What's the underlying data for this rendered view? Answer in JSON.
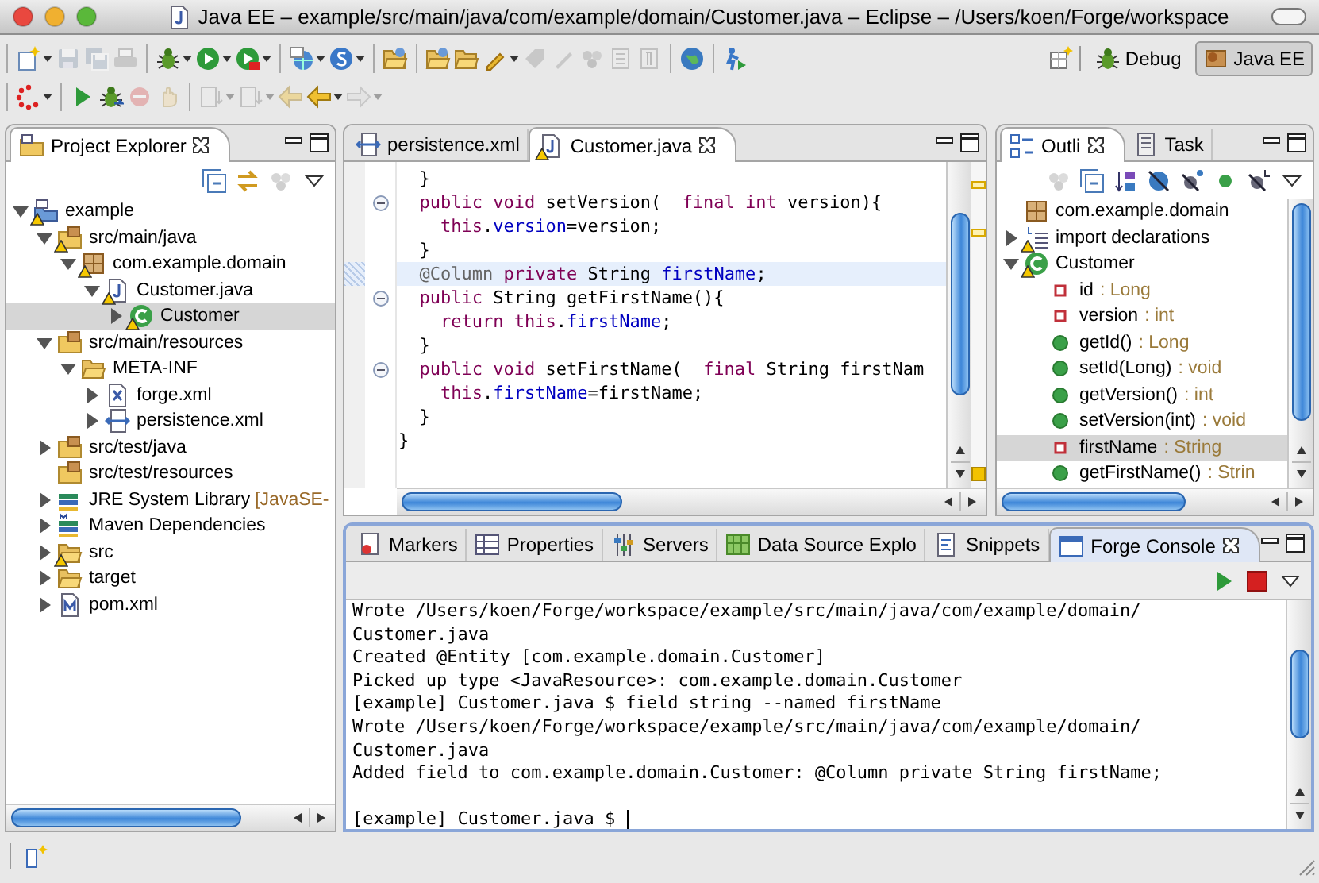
{
  "window": {
    "title": "Java EE – example/src/main/java/com/example/domain/Customer.java – Eclipse – /Users/koen/Forge/workspace"
  },
  "toolbar": {
    "rows": [
      [
        [
          {
            "kind": "new",
            "disabled": false,
            "dropdown": true
          },
          {
            "kind": "save",
            "disabled": true,
            "dropdown": false
          },
          {
            "kind": "save-all",
            "disabled": true,
            "dropdown": false
          },
          {
            "kind": "print",
            "disabled": true,
            "dropdown": false
          }
        ],
        [
          {
            "kind": "bug",
            "disabled": false,
            "dropdown": true
          },
          {
            "kind": "run",
            "disabled": false,
            "dropdown": true
          },
          {
            "kind": "external",
            "disabled": false,
            "dropdown": true
          }
        ],
        [
          {
            "kind": "server",
            "disabled": false,
            "dropdown": true
          },
          {
            "kind": "service",
            "disabled": false,
            "dropdown": true
          }
        ],
        [
          {
            "kind": "open",
            "disabled": false,
            "dropdown": false
          }
        ],
        [
          {
            "kind": "open",
            "disabled": false,
            "dropdown": false
          },
          {
            "kind": "folder",
            "disabled": false,
            "dropdown": false
          },
          {
            "kind": "pen",
            "disabled": false,
            "dropdown": true
          },
          {
            "kind": "tag",
            "disabled": true,
            "dropdown": false
          },
          {
            "kind": "pencil",
            "disabled": true,
            "dropdown": false
          },
          {
            "kind": "dots",
            "disabled": true,
            "dropdown": false
          },
          {
            "kind": "page",
            "disabled": true,
            "dropdown": false
          },
          {
            "kind": "paragraph",
            "disabled": true,
            "dropdown": false
          }
        ],
        [
          {
            "kind": "globe",
            "disabled": false,
            "dropdown": false
          }
        ],
        [
          {
            "kind": "runner",
            "disabled": false,
            "dropdown": false
          }
        ]
      ],
      [
        [
          {
            "kind": "spinner",
            "disabled": false,
            "dropdown": true
          }
        ],
        [
          {
            "kind": "play",
            "disabled": false,
            "dropdown": false
          },
          {
            "kind": "step",
            "disabled": false,
            "dropdown": false
          },
          {
            "kind": "stop",
            "disabled": true,
            "dropdown": false
          },
          {
            "kind": "hand",
            "disabled": true,
            "dropdown": false
          }
        ],
        [
          {
            "kind": "page-arrow",
            "disabled": true,
            "dropdown": true
          },
          {
            "kind": "page-arrow",
            "disabled": true,
            "dropdown": true
          },
          {
            "kind": "back",
            "disabled": true,
            "dropdown": false
          },
          {
            "kind": "back",
            "disabled": false,
            "dropdown": true
          },
          {
            "kind": "forward",
            "disabled": true,
            "dropdown": true
          }
        ]
      ]
    ]
  },
  "perspectives": [
    {
      "label": "Debug",
      "kind": "bug",
      "selected": false
    },
    {
      "label": "Java EE",
      "kind": "javaee",
      "selected": true
    }
  ],
  "project_explorer": {
    "tabs": [
      {
        "label": "Project Explorer",
        "kind": "explorer",
        "selected": true
      }
    ],
    "toolbar": [
      {
        "kind": "collapse",
        "disabled": false
      },
      {
        "kind": "link",
        "disabled": false
      },
      {
        "kind": "dots",
        "disabled": true
      },
      {
        "kind": "menu",
        "disabled": false
      }
    ],
    "tree": [
      {
        "label": "example",
        "kind": "project",
        "warning": true,
        "expanded": true,
        "selected": false,
        "children": [
          {
            "label": "src/main/java",
            "kind": "src",
            "warning": true,
            "expanded": true,
            "selected": false,
            "children": [
              {
                "label": "com.example.domain",
                "kind": "package",
                "warning": true,
                "expanded": true,
                "selected": false,
                "children": [
                  {
                    "label": "Customer.java",
                    "kind": "java",
                    "warning": true,
                    "expanded": true,
                    "selected": false,
                    "children": [
                      {
                        "label": "Customer",
                        "kind": "class",
                        "warning": true,
                        "expanded": false,
                        "selected": true
                      }
                    ]
                  }
                ]
              }
            ]
          },
          {
            "label": "src/main/resources",
            "kind": "src",
            "warning": false,
            "expanded": true,
            "selected": false,
            "children": [
              {
                "label": "META-INF",
                "kind": "folder-open",
                "warning": false,
                "expanded": true,
                "selected": false,
                "children": [
                  {
                    "label": "forge.xml",
                    "kind": "xml",
                    "warning": false,
                    "expanded": false,
                    "selected": false
                  },
                  {
                    "label": "persistence.xml",
                    "kind": "persistence",
                    "warning": false,
                    "expanded": false,
                    "selected": false
                  }
                ]
              }
            ]
          },
          {
            "label": "src/test/java",
            "kind": "src",
            "warning": false,
            "expanded": false,
            "selected": false
          },
          {
            "label": "src/test/resources",
            "kind": "src",
            "warning": false,
            "selected": false
          },
          {
            "label": "JRE System Library",
            "decoration": "[JavaSE-",
            "kind": "library",
            "warning": false,
            "expanded": false,
            "selected": false
          },
          {
            "label": "Maven Dependencies",
            "kind": "maven",
            "warning": false,
            "expanded": false,
            "selected": false
          },
          {
            "label": "src",
            "kind": "folder-open",
            "warning": true,
            "expanded": false,
            "selected": false
          },
          {
            "label": "target",
            "kind": "folder-open",
            "warning": false,
            "expanded": false,
            "selected": false
          },
          {
            "label": "pom.xml",
            "kind": "pom",
            "warning": false,
            "expanded": false,
            "selected": false
          }
        ]
      }
    ]
  },
  "editor": {
    "tabs": [
      {
        "label": "persistence.xml",
        "kind": "persistence",
        "warning": false,
        "selected": false
      },
      {
        "label": "Customer.java",
        "kind": "java",
        "warning": true,
        "selected": true
      }
    ],
    "lines": [
      {
        "fold": false,
        "highlighted": false,
        "tokens": [
          {
            "kind": "plain",
            "text": "  }"
          }
        ]
      },
      {
        "fold": true,
        "highlighted": false,
        "tokens": [
          {
            "kind": "keyword",
            "text": "  public void"
          },
          {
            "kind": "plain",
            "text": " setVersion(  "
          },
          {
            "kind": "keyword",
            "text": "final int"
          },
          {
            "kind": "plain",
            "text": " version){"
          }
        ]
      },
      {
        "fold": false,
        "highlighted": false,
        "tokens": [
          {
            "kind": "keyword",
            "text": "    this"
          },
          {
            "kind": "plain",
            "text": "."
          },
          {
            "kind": "field",
            "text": "version"
          },
          {
            "kind": "plain",
            "text": "=version;"
          }
        ]
      },
      {
        "fold": false,
        "highlighted": false,
        "tokens": [
          {
            "kind": "plain",
            "text": "  }"
          }
        ]
      },
      {
        "fold": false,
        "highlighted": true,
        "tokens": [
          {
            "kind": "annotation",
            "text": "  @Column"
          },
          {
            "kind": "keyword",
            "text": " private"
          },
          {
            "kind": "plain",
            "text": " String "
          },
          {
            "kind": "field",
            "text": "firstName"
          },
          {
            "kind": "plain",
            "text": ";"
          }
        ]
      },
      {
        "fold": true,
        "highlighted": false,
        "tokens": [
          {
            "kind": "keyword",
            "text": "  public"
          },
          {
            "kind": "plain",
            "text": " String getFirstName(){"
          }
        ]
      },
      {
        "fold": false,
        "highlighted": false,
        "tokens": [
          {
            "kind": "keyword",
            "text": "    return this"
          },
          {
            "kind": "plain",
            "text": "."
          },
          {
            "kind": "field",
            "text": "firstName"
          },
          {
            "kind": "plain",
            "text": ";"
          }
        ]
      },
      {
        "fold": false,
        "highlighted": false,
        "tokens": [
          {
            "kind": "plain",
            "text": "  }"
          }
        ]
      },
      {
        "fold": true,
        "highlighted": false,
        "tokens": [
          {
            "kind": "keyword",
            "text": "  public void"
          },
          {
            "kind": "plain",
            "text": " setFirstName(  "
          },
          {
            "kind": "keyword",
            "text": "final"
          },
          {
            "kind": "plain",
            "text": " String firstNam"
          }
        ]
      },
      {
        "fold": false,
        "highlighted": false,
        "tokens": [
          {
            "kind": "keyword",
            "text": "    this"
          },
          {
            "kind": "plain",
            "text": "."
          },
          {
            "kind": "field",
            "text": "firstName"
          },
          {
            "kind": "plain",
            "text": "=firstName;"
          }
        ]
      },
      {
        "fold": false,
        "highlighted": false,
        "tokens": [
          {
            "kind": "plain",
            "text": "  }"
          }
        ]
      },
      {
        "fold": false,
        "highlighted": false,
        "tokens": [
          {
            "kind": "plain",
            "text": "}"
          }
        ]
      }
    ]
  },
  "outline": {
    "tabs": [
      {
        "label": "Outli",
        "kind": "outline",
        "selected": true
      },
      {
        "label": "Task",
        "kind": "notepad",
        "selected": false
      }
    ],
    "toolbar": [
      {
        "kind": "dots",
        "disabled": true
      },
      {
        "kind": "collapse",
        "disabled": false
      },
      {
        "kind": "sort",
        "disabled": false
      },
      {
        "kind": "hide-fields",
        "disabled": false
      },
      {
        "kind": "hide-static",
        "disabled": false
      },
      {
        "kind": "dot",
        "disabled": false
      },
      {
        "kind": "hide-local",
        "disabled": false
      },
      {
        "kind": "menu",
        "disabled": false
      }
    ],
    "tree": [
      {
        "label": "com.example.domain",
        "kind": "package",
        "warning": false,
        "selected": false
      },
      {
        "label": "import declarations",
        "kind": "imports",
        "warning": true,
        "expanded": false,
        "selected": false
      },
      {
        "label": "Customer",
        "kind": "class",
        "warning": true,
        "expanded": true,
        "selected": false,
        "children": [
          {
            "label": "id",
            "type": ": Long",
            "kind": "field",
            "warning": false,
            "selected": false
          },
          {
            "label": "version",
            "type": ": int",
            "kind": "field",
            "warning": false,
            "selected": false
          },
          {
            "label": "getId()",
            "type": ": Long",
            "kind": "method",
            "warning": false,
            "selected": false
          },
          {
            "label": "setId(Long)",
            "type": ": void",
            "kind": "method",
            "warning": false,
            "selected": false
          },
          {
            "label": "getVersion()",
            "type": ": int",
            "kind": "method",
            "warning": false,
            "selected": false
          },
          {
            "label": "setVersion(int)",
            "type": ": void",
            "kind": "method",
            "warning": false,
            "selected": false
          },
          {
            "label": "firstName",
            "type": ": String",
            "kind": "field",
            "warning": false,
            "selected": true
          },
          {
            "label": "getFirstName()",
            "type": ": Strin",
            "kind": "method",
            "warning": false,
            "selected": false
          }
        ]
      }
    ]
  },
  "console": {
    "active": true,
    "tabs": [
      {
        "label": "Markers",
        "kind": "markers",
        "selected": false
      },
      {
        "label": "Properties",
        "kind": "properties",
        "selected": false
      },
      {
        "label": "Servers",
        "kind": "servers",
        "selected": false
      },
      {
        "label": "Data Source Explo",
        "kind": "datasource",
        "selected": false
      },
      {
        "label": "Snippets",
        "kind": "snippets",
        "selected": false
      },
      {
        "label": "Forge Console",
        "kind": "console",
        "selected": true
      }
    ],
    "toolbar": [
      {
        "kind": "play",
        "disabled": false
      },
      {
        "kind": "stop-square",
        "disabled": false
      },
      {
        "kind": "menu",
        "disabled": false
      }
    ],
    "lines": [
      "Wrote /Users/koen/Forge/workspace/example/src/main/java/com/example/domain/",
      "Customer.java",
      "Created @Entity [com.example.domain.Customer]",
      "Picked up type <JavaResource>: com.example.domain.Customer",
      "[example] Customer.java $ field string --named firstName",
      "Wrote /Users/koen/Forge/workspace/example/src/main/java/com/example/domain/",
      "Customer.java",
      "Added field to com.example.domain.Customer: @Column private String firstName;"
    ],
    "prompt": "[example] Customer.java $"
  }
}
